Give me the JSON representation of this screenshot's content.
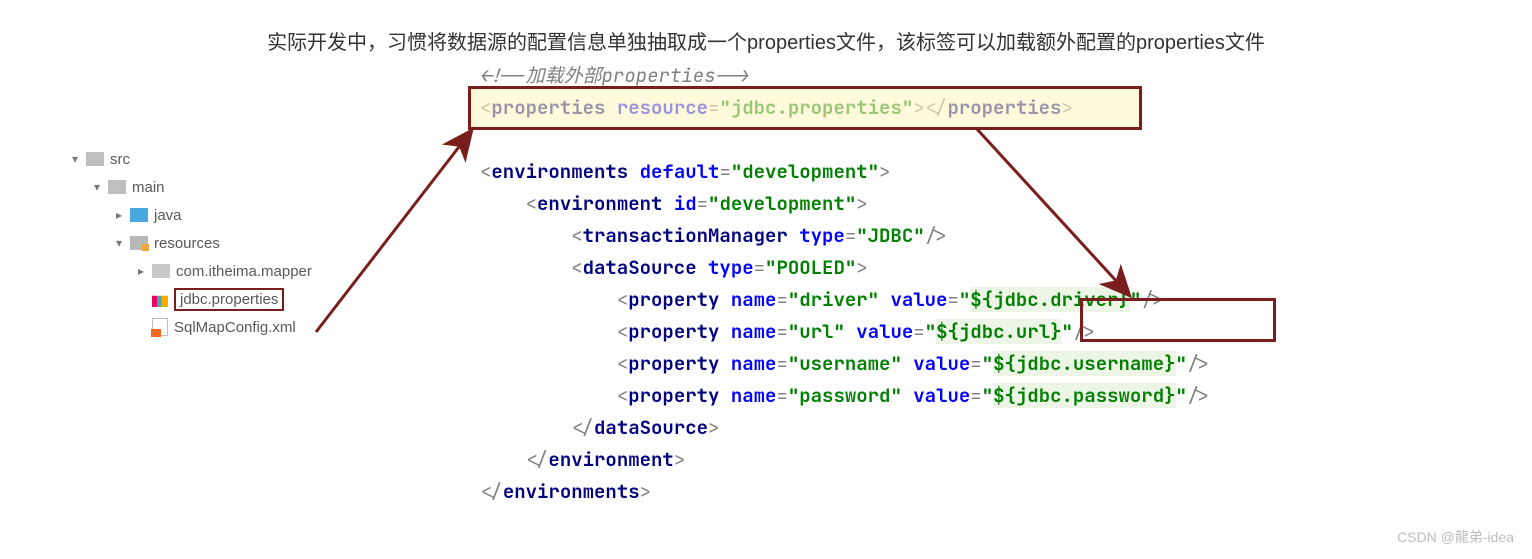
{
  "header": "实际开发中，习惯将数据源的配置信息单独抽取成一个properties文件，该标签可以加载额外配置的properties文件",
  "tree": {
    "src": "src",
    "main": "main",
    "java": "java",
    "resources": "resources",
    "mapper": "com.itheima.mapper",
    "jdbc": "jdbc.properties",
    "sqlmap": "SqlMapConfig.xml"
  },
  "code": {
    "comment_open": "<!--",
    "comment_text": "加载外部properties",
    "comment_close": "-->",
    "prop_open": "<",
    "prop_tag": "properties",
    "prop_attr": "resource",
    "prop_val": "\"jdbc.properties\"",
    "prop_mid": "></",
    "prop_end": ">",
    "envs_open": "<",
    "envs_tag": "environments",
    "envs_attr": "default",
    "envs_val": "\"development\"",
    "env_tag": "environment",
    "env_attr": "id",
    "env_val": "\"development\"",
    "tm_tag": "transactionManager",
    "tm_attr": "type",
    "tm_val": "\"JDBC\"",
    "ds_tag": "dataSource",
    "ds_attr": "type",
    "ds_val": "\"POOLED\"",
    "p_tag": "property",
    "p_name": "name",
    "p_value": "value",
    "p1_name": "\"driver\"",
    "p1_val_q1": "\"",
    "p1_val_pl": "${jdbc.driver}",
    "p1_val_q2": "\"",
    "p2_name": "\"url\"",
    "p2_val_q1": "\"",
    "p2_val_pl": "${jdbc.url}",
    "p2_val_q2": "\"",
    "p3_name": "\"username\"",
    "p3_val_q1": "\"",
    "p3_val_pl": "${jdbc.username}",
    "p3_val_q2": "\"",
    "p4_name": "\"password\"",
    "p4_val_q1": "\"",
    "p4_val_pl": "${jdbc.password}",
    "p4_val_q2": "\"",
    "close_ds": "dataSource",
    "close_env": "environment",
    "close_envs": "environments"
  },
  "watermark": "CSDN @龍弟-idea"
}
